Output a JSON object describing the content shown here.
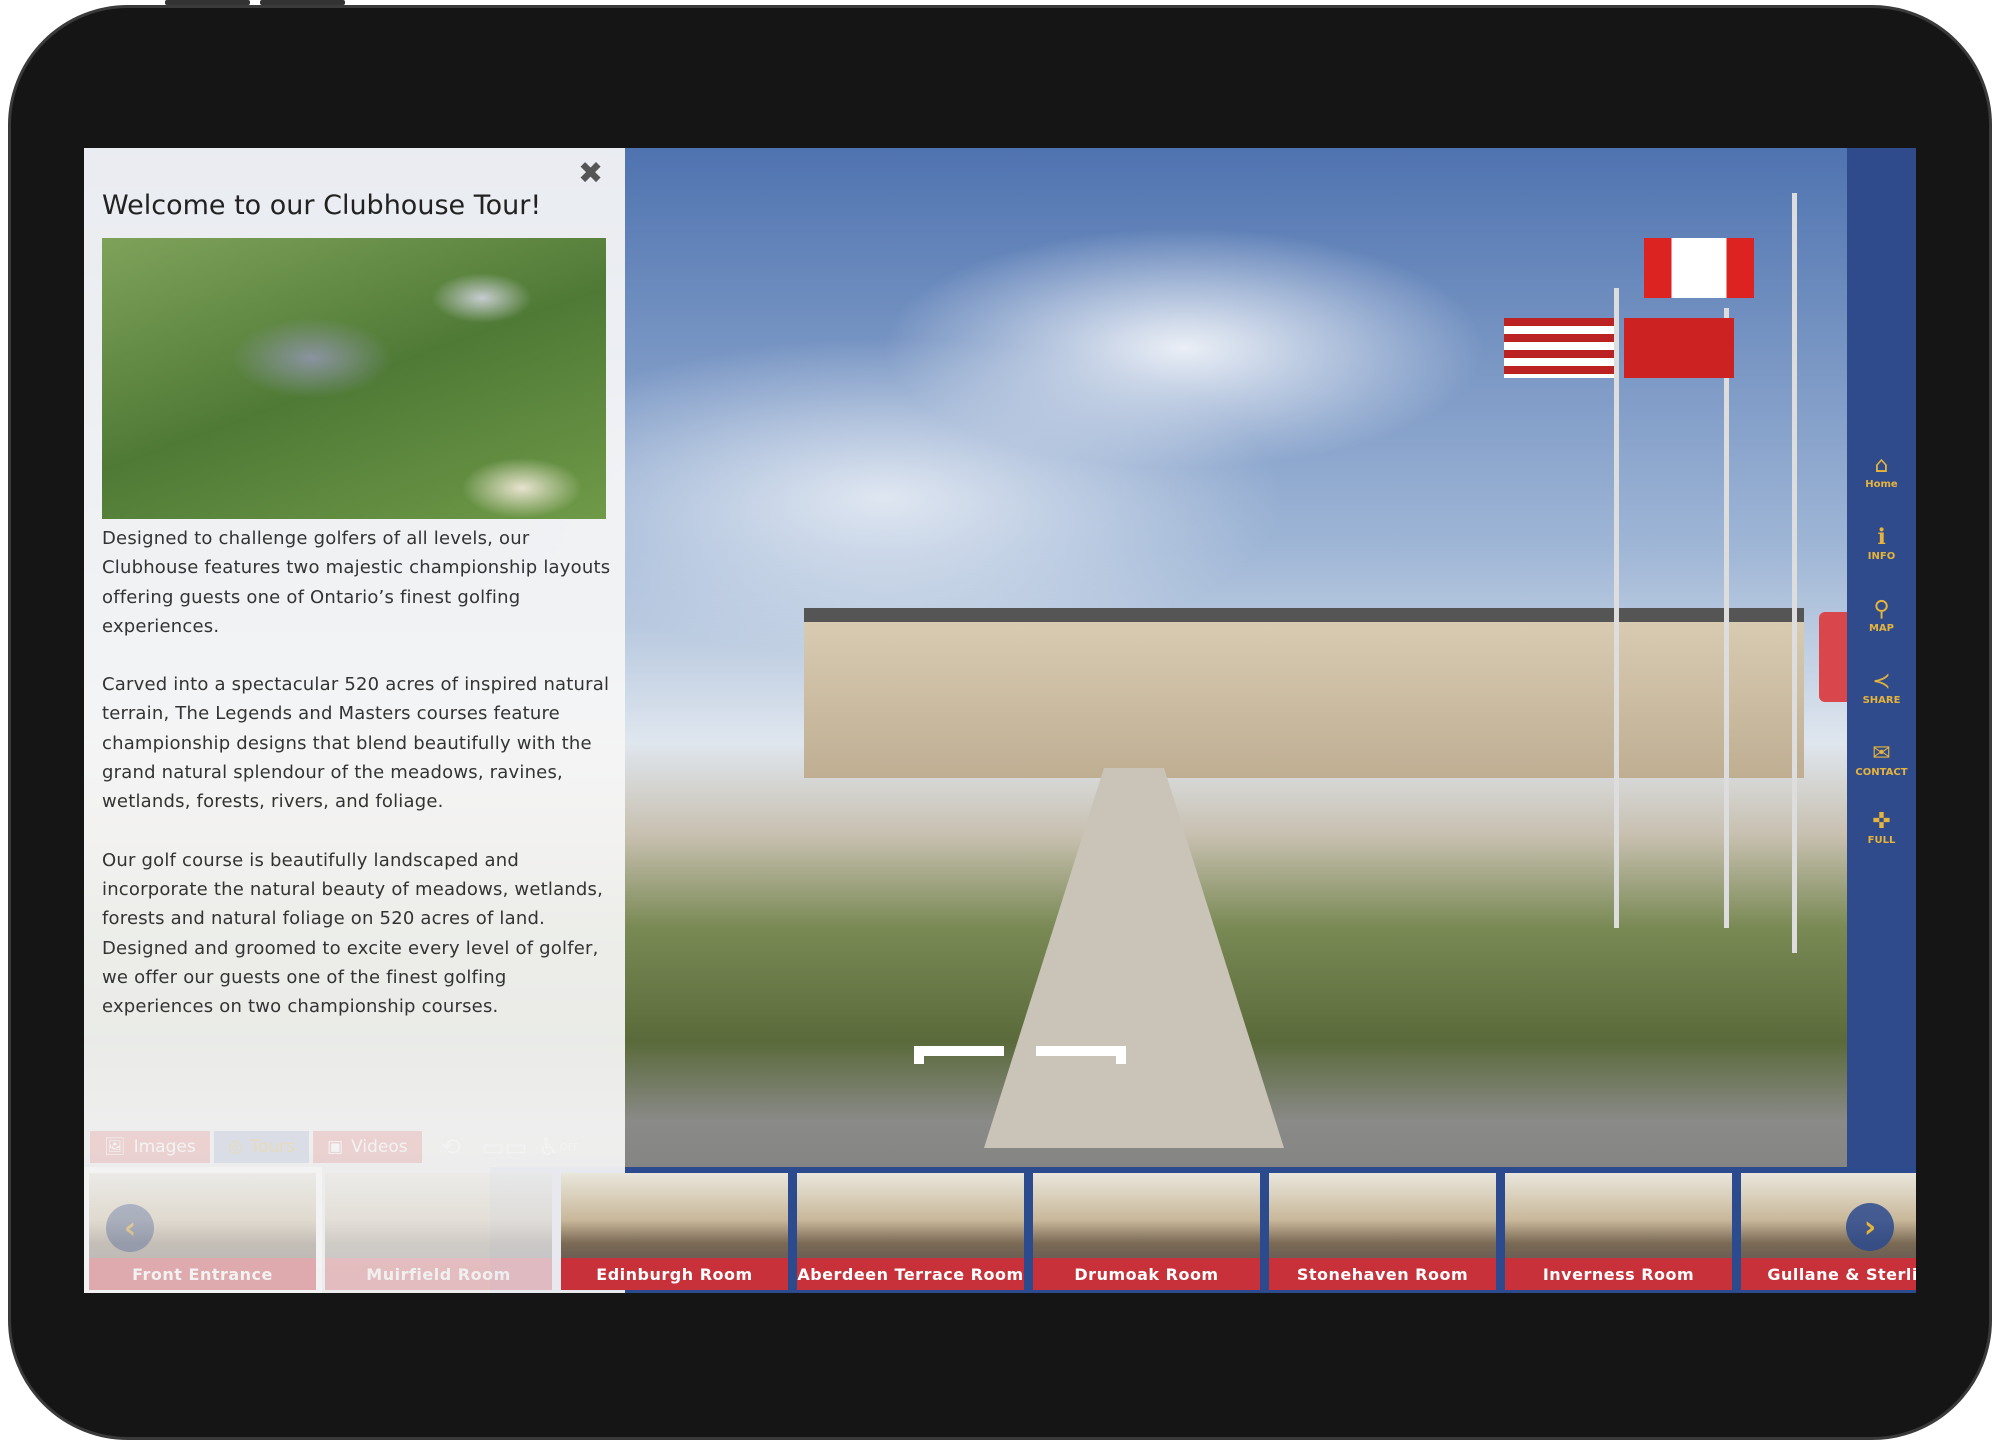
{
  "panel": {
    "title": "Welcome to our Clubhouse Tour!",
    "close_icon": "close-icon",
    "paragraphs": [
      "Designed to challenge golfers of all levels, our Clubhouse features two majestic championship layouts offering guests one of Ontario’s finest golfing experiences.",
      "Carved into a spectacular 520 acres of inspired natural terrain, The Legends and Masters courses feature championship designs that blend beautifully with the grand natural splendour of the meadows, ravines, wetlands, forests, rivers, and foliage.",
      "Our golf course is beautifully landscaped and incorporate the natural beauty of meadows, wetlands, forests and natural foliage on 520 acres of land. Designed and groomed to excite every level of golfer, we offer our guests one of the finest golfing experiences on two championship courses."
    ]
  },
  "media_tabs": [
    {
      "label": "Images",
      "icon": "image-icon"
    },
    {
      "label": "Tours",
      "icon": "360-icon"
    },
    {
      "label": "Videos",
      "icon": "film-icon"
    }
  ],
  "tools": {
    "rotate_icon": "rotate-icon",
    "vr_icon": "vr-goggles-icon",
    "accessibility_icon": "wheelchair-icon",
    "accessibility_state": "OFF"
  },
  "thumbnails": [
    "Front Entrance",
    "Muirfield Room",
    "Edinburgh Room",
    "Aberdeen Terrace Room",
    "Drumoak Room",
    "Stonehaven Room",
    "Inverness Room",
    "Gullane & Sterling"
  ],
  "sidebar": [
    {
      "label": "Home",
      "icon": "home-icon"
    },
    {
      "label": "INFO",
      "icon": "info-icon"
    },
    {
      "label": "MAP",
      "icon": "map-pin-icon"
    },
    {
      "label": "SHARE",
      "icon": "share-icon"
    },
    {
      "label": "CONTACT",
      "icon": "envelope-icon"
    },
    {
      "label": "FULL",
      "icon": "fullscreen-icon"
    }
  ],
  "colors": {
    "brand_blue": "#2f4b8c",
    "accent_gold": "#e6b43c",
    "label_red": "#c8313a"
  }
}
